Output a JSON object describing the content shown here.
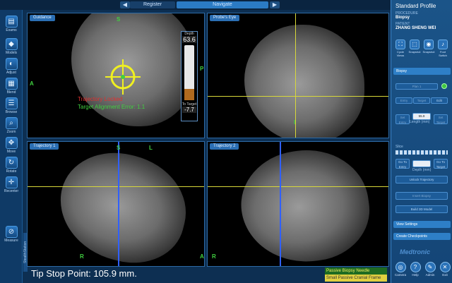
{
  "topbar": {
    "register": "Register",
    "navigate": "Navigate",
    "back": "◀",
    "forward": "▶"
  },
  "left_tools": [
    {
      "name": "tool-exams",
      "glyph": "▤",
      "label": "Exams"
    },
    {
      "name": "tool-models",
      "glyph": "◆",
      "label": "Models"
    },
    {
      "name": "tool-adjust",
      "glyph": "◐",
      "label": "Adjust"
    },
    {
      "name": "tool-blend",
      "glyph": "▦",
      "label": "Blend"
    },
    {
      "name": "tool-browse",
      "glyph": "☰",
      "label": "Browse"
    },
    {
      "name": "tool-zoom",
      "glyph": "⌕",
      "label": "Zoom"
    },
    {
      "name": "tool-move",
      "glyph": "✥",
      "label": "Move"
    },
    {
      "name": "tool-rotate",
      "glyph": "↻",
      "label": "Rotate"
    },
    {
      "name": "tool-reset",
      "glyph": "✛",
      "label": "Recenter"
    },
    {
      "name": "tool-measure",
      "glyph": "⊘",
      "label": "Measure"
    }
  ],
  "viewports": {
    "guidance": "Guidance",
    "probes_eye": "Probe's Eye",
    "trajectory1": "Trajectory 1",
    "trajectory2": "Trajectory 2"
  },
  "orient": {
    "s": "S",
    "p": "P",
    "a": "A",
    "i": "I",
    "l": "L",
    "r": "R"
  },
  "gauge": {
    "title": "Depth",
    "depth": "63.6",
    "depth_fraction": 0.2,
    "sub": "To Target",
    "to_target": "-7.7"
  },
  "status": {
    "locked": "Trajectory Locked",
    "error": "Target Alignment Error: 1.1",
    "tip_stop": "Tip Stop Point: 105.9 mm."
  },
  "legend": {
    "line1": "Passive Biopsy Needle",
    "line2": "Small Passive Cranial Frame"
  },
  "right_panel": {
    "title": "Standard Profile",
    "procedure_label": "PROCEDURE",
    "procedure": "Biopsy",
    "patient_label": "PATIENT",
    "patient": "ZHANG SHENG WEI",
    "icons": [
      {
        "name": "cycle-views-icon",
        "glyph": "⛶",
        "label": "Cycle Views"
      },
      {
        "name": "snapshot-icon",
        "glyph": "⬚",
        "label": "Snapshot"
      },
      {
        "name": "camera-icon",
        "glyph": "◉",
        "label": "Snapshot"
      },
      {
        "name": "voice-icon",
        "glyph": "♪",
        "label": "Foot Switch"
      }
    ],
    "biopsy_section": "Biopsy",
    "plan": "Plan 1",
    "btn_entry": "Entry",
    "btn_target": "Target",
    "btn_edit": "Edit",
    "set_entry": "Set Entry",
    "value_box": "55.9",
    "value_label": "Length (mm)",
    "set_target": "Set Target",
    "slider_label": "Slice",
    "goto_entry": "Go To Entry",
    "goto_target": "Go To Target",
    "input_label": "Depth (mm)",
    "unlock": "Unlock Trajectory",
    "insert_biopsy": "Insert Biopsy",
    "build_model": "Build 3D Model",
    "view_settings": "View Settings",
    "checkpoints": "Create Checkpoints",
    "brand": "Medtronic",
    "bottom": [
      {
        "name": "camera-button",
        "glyph": "◎",
        "label": "Camera"
      },
      {
        "name": "help-button",
        "glyph": "?",
        "label": "Help"
      },
      {
        "name": "admin-button",
        "glyph": "✎",
        "label": "Admin"
      },
      {
        "name": "exit-button",
        "glyph": "✕",
        "label": "Exit"
      }
    ]
  },
  "side_tab": "StealthStation"
}
